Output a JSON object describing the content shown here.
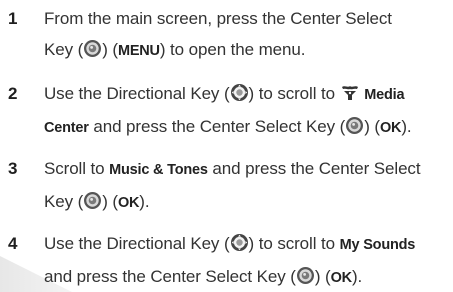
{
  "steps": [
    {
      "number": "1",
      "line1": {
        "t1": "From the main screen, press the Center Select"
      },
      "line2": {
        "t1": "Key (",
        "t2": ") (",
        "k1": "MENU",
        "t3": ") to open the menu."
      }
    },
    {
      "number": "2",
      "line1": {
        "t1": "Use the Directional Key (",
        "t2": ") to scroll to ",
        "k1": "Media"
      },
      "line2": {
        "k1": "Center",
        "t1": " and press the Center Select Key (",
        "t2": ") (",
        "k2": "OK",
        "t3": ")."
      }
    },
    {
      "number": "3",
      "line1": {
        "t1": "Scroll to ",
        "k1": "Music & Tones",
        "t2": " and press the Center Select"
      },
      "line2": {
        "t1": "Key (",
        "t2": ") (",
        "k1": "OK",
        "t3": ")."
      }
    },
    {
      "number": "4",
      "line1": {
        "t1": "Use the Directional Key (",
        "t2": ") to scroll to ",
        "k1": "My Sounds"
      },
      "line2": {
        "t1": "and press the Center Select Key (",
        "t2": ") (",
        "k1": "OK",
        "t3": ")."
      }
    }
  ],
  "icons": {
    "center_select": "center-select-key-icon",
    "directional": "directional-key-icon",
    "media_center": "media-center-icon"
  }
}
